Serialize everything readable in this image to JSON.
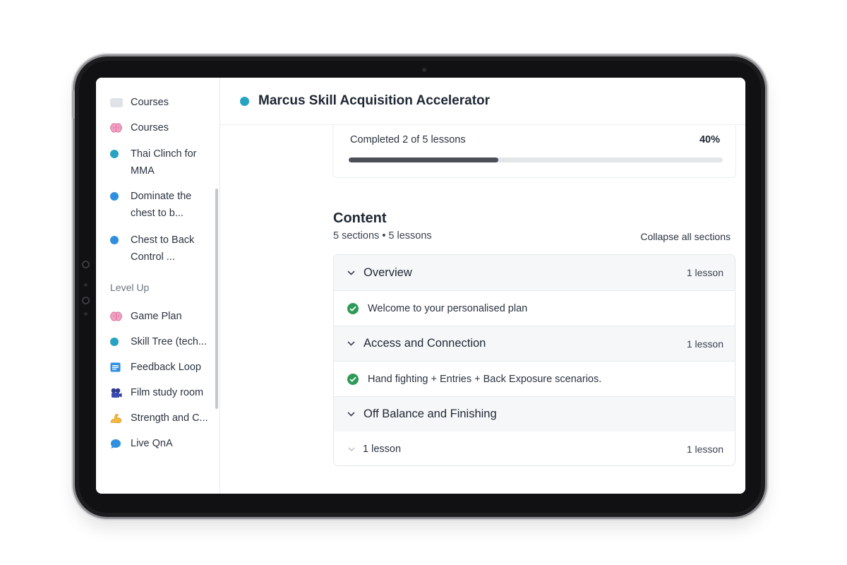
{
  "app": {
    "title": "Marcus Skill Acquisition Accelerator",
    "accent_color": "#27a2c3"
  },
  "sidebar": {
    "items": [
      {
        "label": "Courses",
        "icon": "folder-icon"
      },
      {
        "label": "Courses",
        "icon": "brain-icon"
      },
      {
        "label": "Thai Clinch for MMA",
        "icon": "teal-dot-icon"
      },
      {
        "label": "Dominate the chest to b...",
        "icon": "blue-dot-icon"
      },
      {
        "label": "Chest to Back Control ...",
        "icon": "blue-dot-icon"
      }
    ],
    "section_title": "Level Up",
    "section_items": [
      {
        "label": "Game Plan",
        "icon": "brain-icon"
      },
      {
        "label": "Skill Tree (tech...",
        "icon": "teal-dot-icon"
      },
      {
        "label": "Feedback Loop",
        "icon": "notes-icon"
      },
      {
        "label": "Film study room",
        "icon": "film-icon"
      },
      {
        "label": "Strength and C...",
        "icon": "flexed-arm-icon"
      },
      {
        "label": "Live QnA",
        "icon": "speech-bubble-icon"
      }
    ]
  },
  "progress": {
    "text": "Completed 2 of 5 lessons",
    "percent_label": "40%",
    "fraction": 0.4
  },
  "content": {
    "title": "Content",
    "meta": "5 sections • 5 lessons",
    "collapse_label": "Collapse all sections",
    "sections": [
      {
        "title": "Overview",
        "count": "1 lesson",
        "lesson": "Welcome to your personalised plan"
      },
      {
        "title": "Access and Connection",
        "count": "1 lesson",
        "lesson": "Hand fighting + Entries + Back Exposure scenarios."
      },
      {
        "title": "Off Balance and Finishing",
        "count": "",
        "lesson_label": "1 lesson",
        "lesson_count": "1 lesson"
      }
    ]
  }
}
